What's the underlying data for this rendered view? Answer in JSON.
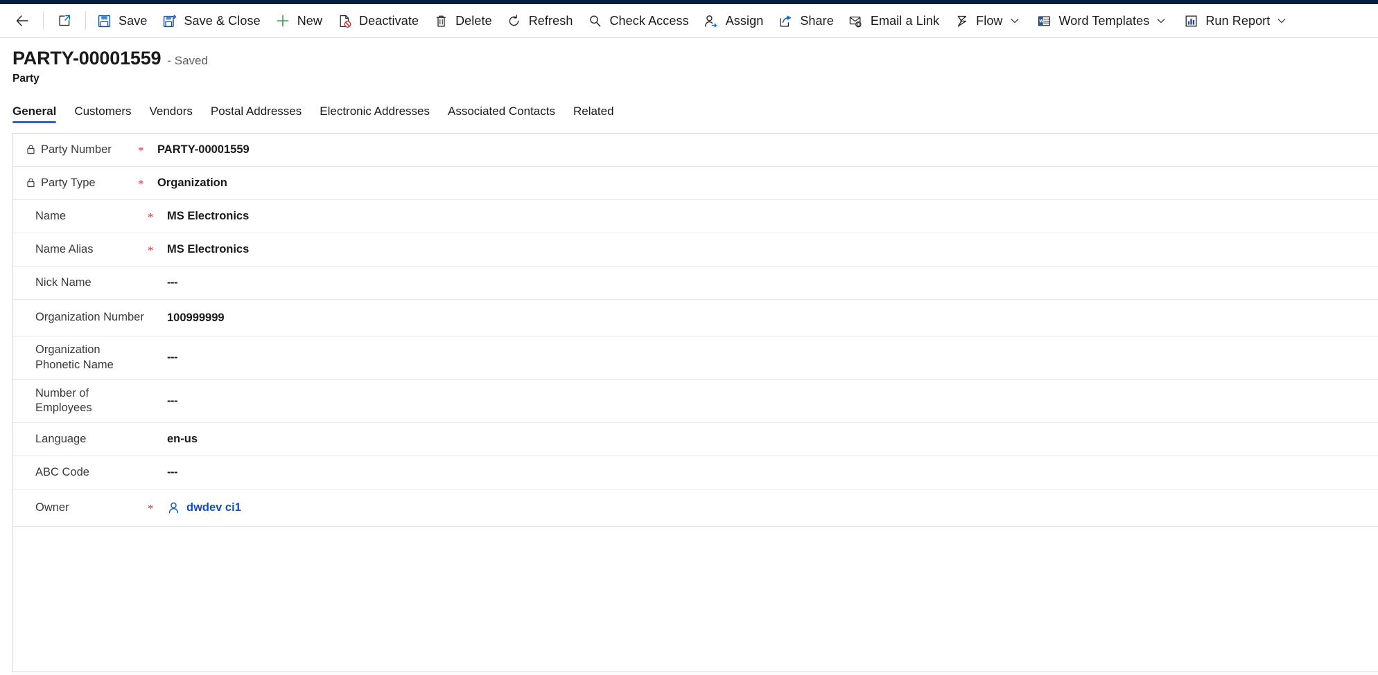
{
  "theme": {
    "accent": "#2266cc",
    "link": "#1250b0",
    "required": "#e02b2b",
    "topbar": "#071f3f",
    "text": "#1b1a19",
    "label": "#3b3a39",
    "divider": "#e6e6e6"
  },
  "command_bar": {
    "back_label": "Back",
    "popout_label": "Open in new window",
    "buttons": [
      {
        "icon": "save-icon",
        "label": "Save"
      },
      {
        "icon": "save-and-close-icon",
        "label": "Save & Close"
      },
      {
        "icon": "new-plus-icon",
        "label": "New"
      },
      {
        "icon": "deactivate-icon",
        "label": "Deactivate"
      },
      {
        "icon": "delete-trash-icon",
        "label": "Delete"
      },
      {
        "icon": "refresh-icon",
        "label": "Refresh"
      },
      {
        "icon": "check-access-icon",
        "label": "Check Access"
      },
      {
        "icon": "assign-person-icon",
        "label": "Assign"
      },
      {
        "icon": "share-icon",
        "label": "Share"
      },
      {
        "icon": "email-link-icon",
        "label": "Email a Link"
      },
      {
        "icon": "flow-icon",
        "label": "Flow",
        "has_chevron": true
      },
      {
        "icon": "word-templates-icon",
        "label": "Word Templates",
        "has_chevron": true
      },
      {
        "icon": "run-report-icon",
        "label": "Run Report",
        "has_chevron": true
      }
    ]
  },
  "record": {
    "title": "PARTY-00001559",
    "status": "- Saved",
    "entity": "Party"
  },
  "tabs": [
    {
      "label": "General",
      "active": true
    },
    {
      "label": "Customers",
      "active": false
    },
    {
      "label": "Vendors",
      "active": false
    },
    {
      "label": "Postal Addresses",
      "active": false
    },
    {
      "label": "Electronic Addresses",
      "active": false
    },
    {
      "label": "Associated Contacts",
      "active": false
    },
    {
      "label": "Related",
      "active": false
    }
  ],
  "form": {
    "fields": [
      {
        "label": "Party Number",
        "value": "PARTY-00001559",
        "required": "*",
        "locked": true,
        "multiline": false
      },
      {
        "label": "Party Type",
        "value": "Organization",
        "required": "*",
        "locked": true,
        "multiline": false
      },
      {
        "label": "Name",
        "value": "MS Electronics",
        "required": "*",
        "locked": false,
        "multiline": false
      },
      {
        "label": "Name Alias",
        "value": "MS Electronics",
        "required": "*",
        "locked": false,
        "multiline": false
      },
      {
        "label": "Nick Name",
        "value": "---",
        "required": "",
        "locked": false,
        "multiline": false
      },
      {
        "label": "Organization Number",
        "value": "100999999",
        "required": "",
        "locked": false,
        "multiline": true
      },
      {
        "label": "Organization Phonetic Name",
        "value": "---",
        "required": "",
        "locked": false,
        "multiline": true
      },
      {
        "label": "Number of Employees",
        "value": "---",
        "required": "",
        "locked": false,
        "multiline": true
      },
      {
        "label": "Language",
        "value": "en-us",
        "required": "",
        "locked": false,
        "multiline": false
      },
      {
        "label": "ABC Code",
        "value": "---",
        "required": "",
        "locked": false,
        "multiline": false
      }
    ],
    "owner": {
      "label": "Owner",
      "required": "*",
      "value": "dwdev ci1"
    }
  }
}
